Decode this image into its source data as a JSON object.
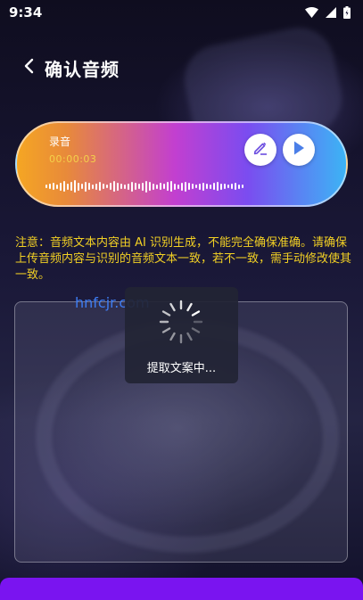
{
  "status_bar": {
    "time": "9:34",
    "icons": [
      "wifi-icon",
      "signal-icon",
      "battery-icon"
    ]
  },
  "header": {
    "back_icon": "chevron-left-icon",
    "title": "确认音频"
  },
  "audio_card": {
    "label": "录音",
    "duration": "00:00:03",
    "edit_icon": "pencil-icon",
    "play_icon": "play-icon",
    "colors": {
      "start": "#f5a623",
      "mid": "#c23fd0",
      "end": "#3cb4f5",
      "time_text": "#f4d14a"
    }
  },
  "notice": {
    "text": "注意：音频文本内容由 AI 识别生成，不能完全确保准确。请确保上传音频内容与识别的音频文本一致，若不一致，需手动修改使其一致。",
    "color": "#f2d024"
  },
  "watermark": {
    "text": "hnfcjr.com"
  },
  "loading": {
    "text": "提取文案中..."
  },
  "bottom_bar": {
    "color": "#7a14f0"
  }
}
